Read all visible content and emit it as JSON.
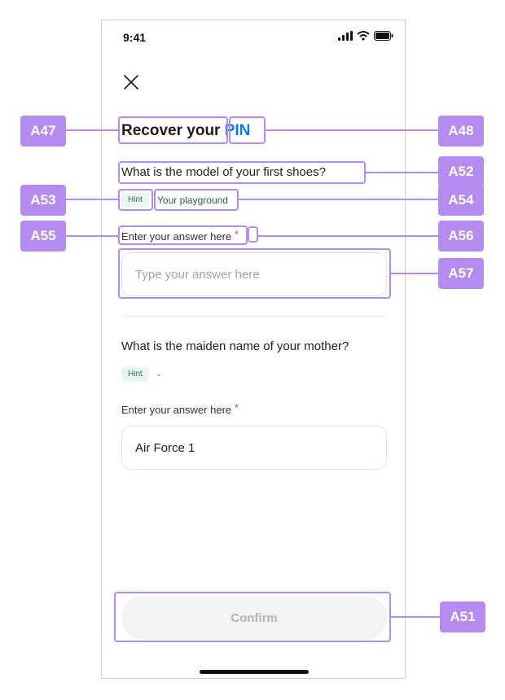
{
  "status_bar": {
    "time": "9:41"
  },
  "title": {
    "prefix": "Recover your ",
    "highlight": "PIN"
  },
  "question_1": {
    "text": "What is the model of your first shoes?",
    "hint_label": "Hint",
    "hint_text": "Your playground",
    "field_label": "Enter your answer here",
    "required_mark": "*",
    "placeholder": "Type your answer here",
    "value": ""
  },
  "question_2": {
    "text": "What is the maiden name of your mother?",
    "hint_label": "Hint",
    "hint_text": "-",
    "field_label": "Enter your answer here",
    "required_mark": "*",
    "value": "Air Force 1"
  },
  "confirm_label": "Confirm",
  "annotations": {
    "a47": "A47",
    "a48": "A48",
    "a51": "A51",
    "a52": "A52",
    "a53": "A53",
    "a54": "A54",
    "a55": "A55",
    "a56": "A56",
    "a57": "A57"
  },
  "colors": {
    "accent": "#0a7bd1",
    "annotation": "#b48cf0",
    "required": "#e0442f",
    "hint_bg": "#eaf6f1"
  }
}
